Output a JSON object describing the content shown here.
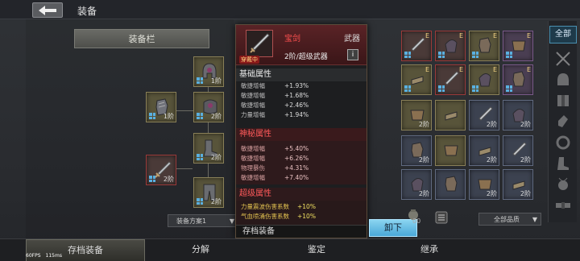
{
  "header": {
    "title": "装备"
  },
  "left_panel": {
    "header_label": "装备栏",
    "slots": [
      {
        "level": "1阶",
        "rarity": "yellow"
      },
      {
        "level": "1阶",
        "rarity": "yellow"
      },
      {
        "level": "2阶",
        "rarity": "yellow"
      },
      {
        "level": "2阶",
        "rarity": "yellow"
      },
      {
        "level": "2阶",
        "rarity": "red"
      },
      {
        "level": "2阶",
        "rarity": "yellow"
      }
    ],
    "scheme_label": "装备方案1"
  },
  "tooltip": {
    "name": "宝剑",
    "type": "武器",
    "equipped_tag": "穿戴中",
    "grade": "2阶/超级武器",
    "info_icon": "i",
    "sections": {
      "basic": {
        "title": "基础属性",
        "stats": [
          {
            "name": "敏捷增幅",
            "value": "+1.93%"
          },
          {
            "name": "敏捷增幅",
            "value": "+1.68%"
          },
          {
            "name": "敏捷增幅",
            "value": "+2.46%"
          },
          {
            "name": "力量增幅",
            "value": "+1.94%"
          }
        ]
      },
      "mystic": {
        "title": "神秘属性",
        "stats": [
          {
            "name": "敏捷增幅",
            "value": "+5.40%"
          },
          {
            "name": "敏捷增幅",
            "value": "+6.26%"
          },
          {
            "name": "物理暴伤",
            "value": "+4.31%"
          },
          {
            "name": "敏捷增幅",
            "value": "+7.40%"
          }
        ]
      },
      "super": {
        "title": "超级属性",
        "stats": [
          {
            "name": "力量震波伤害系数",
            "value": "+10%"
          },
          {
            "name": "气血喷涌伤害系数",
            "value": "+10%"
          }
        ]
      }
    },
    "footer": "存档装备"
  },
  "unload_button": "卸下",
  "inventory": {
    "items": [
      {
        "rarity": "red",
        "tag": "E"
      },
      {
        "rarity": "red",
        "tag": "E"
      },
      {
        "rarity": "yellow",
        "tag": "E"
      },
      {
        "rarity": "purple",
        "tag": "E"
      },
      {
        "rarity": "yellow",
        "tag": "E"
      },
      {
        "rarity": "red",
        "tag": "E"
      },
      {
        "rarity": "yellow",
        "tag": "E"
      },
      {
        "rarity": "purple",
        "tag": "E"
      },
      {
        "rarity": "yellow",
        "level": "2阶"
      },
      {
        "rarity": "yellow",
        "level": ""
      },
      {
        "rarity": "blue",
        "level": "2阶"
      },
      {
        "rarity": "blue",
        "level": "2阶"
      },
      {
        "rarity": "blue",
        "level": "2阶"
      },
      {
        "rarity": "yellow",
        "level": ""
      },
      {
        "rarity": "blue",
        "level": "2阶"
      },
      {
        "rarity": "blue",
        "level": "2阶"
      },
      {
        "rarity": "blue",
        "level": "2阶"
      },
      {
        "rarity": "blue",
        "level": ""
      },
      {
        "rarity": "blue",
        "level": "2阶"
      },
      {
        "rarity": "blue",
        "level": "2阶"
      }
    ],
    "coin_count": "00",
    "quality_filter": "全部品质"
  },
  "categories": {
    "all_label": "全部"
  },
  "bottom_tabs": [
    "存档装备",
    "分解",
    "鉴定",
    "继承"
  ],
  "debug": {
    "fps": "60FPS",
    "ping": "115ms"
  }
}
